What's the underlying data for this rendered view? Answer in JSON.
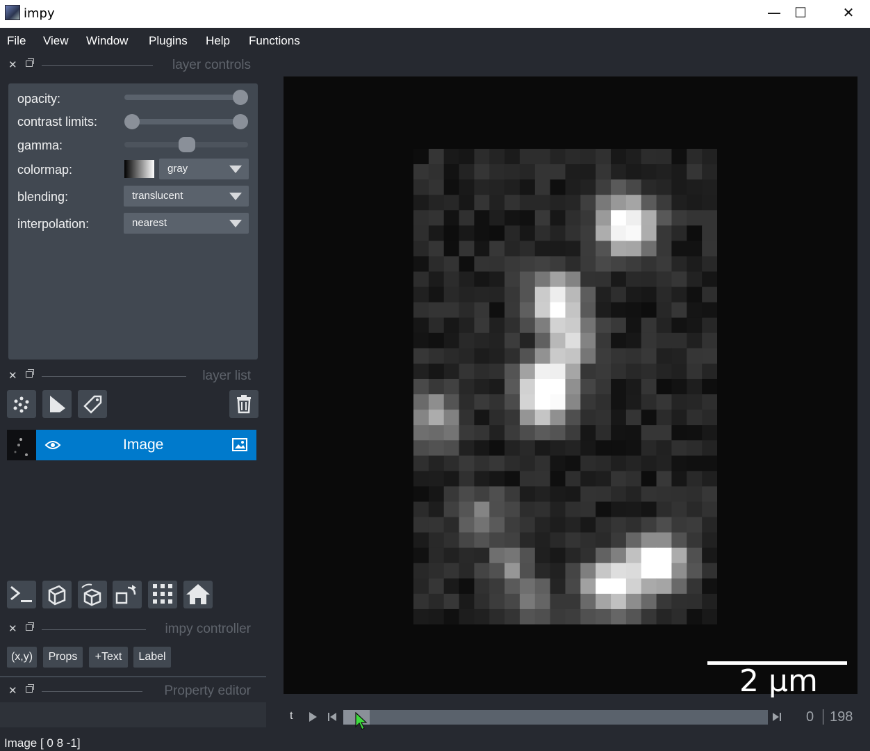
{
  "window": {
    "title": "impy",
    "minimize": "—",
    "maximize": "☐",
    "close": "✕"
  },
  "menu": [
    "File",
    "View",
    "Window",
    "Plugins",
    "Help",
    "Functions"
  ],
  "docks": {
    "layer_controls": "layer controls",
    "layer_list": "layer list",
    "impy_controller": "impy controller",
    "property_editor": "Property editor"
  },
  "layer_controls": {
    "opacity_label": "opacity:",
    "contrast_label": "contrast limits:",
    "gamma_label": "gamma:",
    "colormap_label": "colormap:",
    "colormap_value": "gray",
    "blending_label": "blending:",
    "blending_value": "translucent",
    "interpolation_label": "interpolation:",
    "interpolation_value": "nearest",
    "opacity_level": 1.0,
    "contrast_low": 0.0,
    "contrast_high": 1.0,
    "gamma_level": 0.5
  },
  "layer_list": {
    "layer_name": "Image"
  },
  "controller_buttons": [
    "(x,y)",
    "Props",
    "+Text",
    "Label"
  ],
  "canvas": {
    "scalebar_label": "2 μm"
  },
  "dims": {
    "axis_label": "t",
    "current": "0",
    "max": "198"
  },
  "status": {
    "text": "Image [ 0  8 -1]"
  },
  "colors": {
    "bg": "#262930",
    "panel": "#414851",
    "selected": "#007acc"
  }
}
